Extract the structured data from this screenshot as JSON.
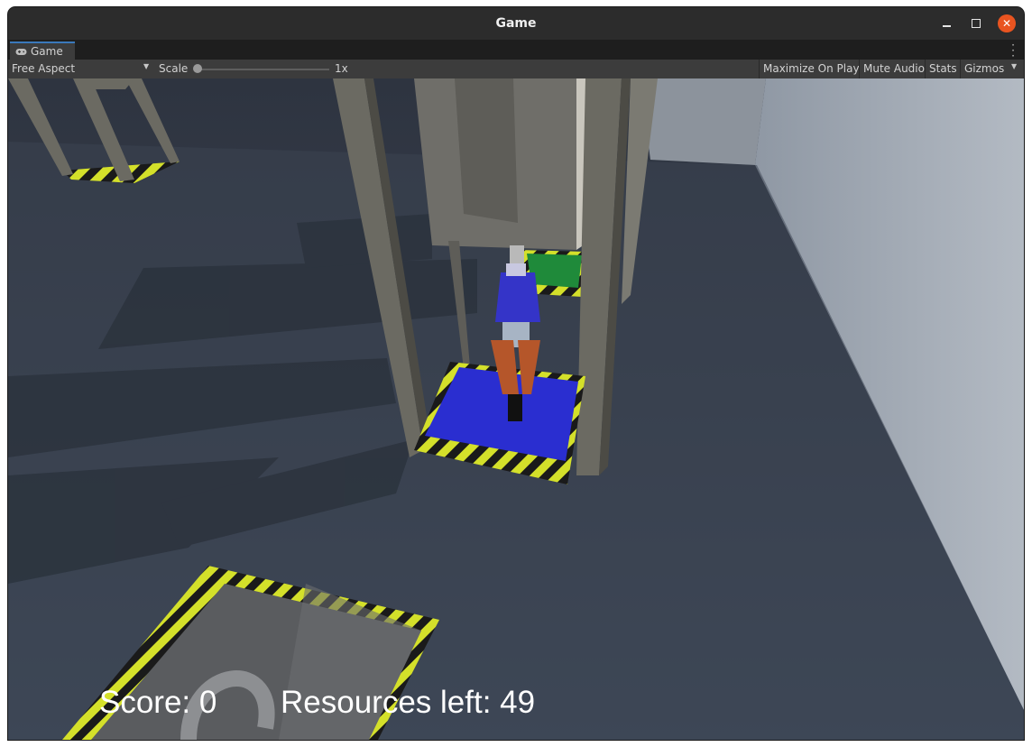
{
  "window": {
    "title": "Game"
  },
  "tabs": [
    {
      "label": "Game",
      "icon": "gamepad-icon"
    }
  ],
  "toolbar": {
    "aspect": "Free Aspect",
    "scale_label": "Scale",
    "scale_value": "1x",
    "maximize_on_play": "Maximize On Play",
    "mute_audio": "Mute Audio",
    "stats": "Stats",
    "gizmos": "Gizmos"
  },
  "hud": {
    "score": "Score: 0",
    "resources": "Resources left: 49"
  },
  "colors": {
    "title_bar": "#2c2c2c",
    "toolbar": "#3c3c3c",
    "close_button": "#e95420",
    "tab_accent": "#3a79bb",
    "floor": "#3d4756",
    "wall": "#a5adb7",
    "blue_pad": "#2a2ed0",
    "green_pad": "#1f8a3a",
    "hazard_yellow": "#d4e02a",
    "flask": "#3434c8"
  }
}
